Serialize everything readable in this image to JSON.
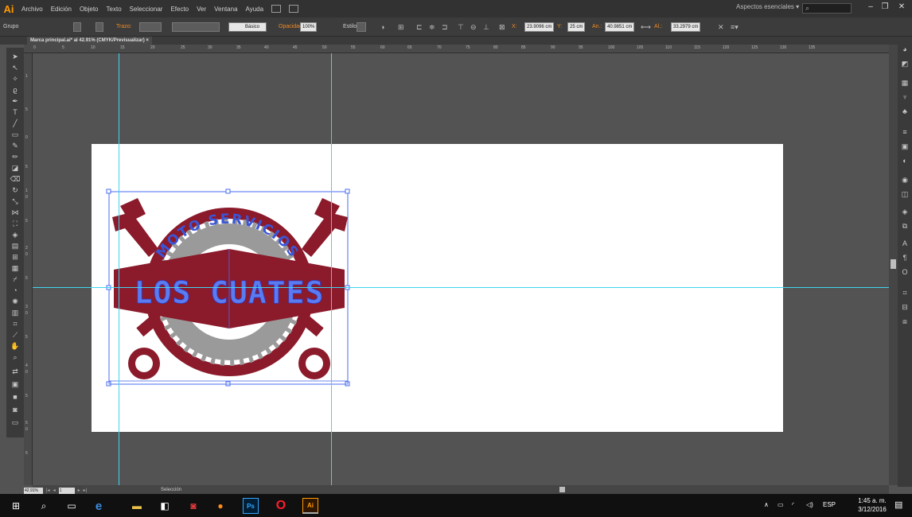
{
  "menubar": {
    "app_logo": "Ai",
    "items": [
      "Archivo",
      "Edición",
      "Objeto",
      "Texto",
      "Seleccionar",
      "Efecto",
      "Ver",
      "Ventana",
      "Ayuda"
    ],
    "workspace": "Aspectos esenciales",
    "workspace_arrow": "▾"
  },
  "controlbar": {
    "selection_type": "Grupo",
    "stroke_label": "Trazo:",
    "stroke_profile": "Básico",
    "opacity_label": "Opacidad:",
    "opacity_value": "100%",
    "style_label": "Estilo:",
    "x_label": "X:",
    "x_value": "23.9096 cm",
    "y_label": "Y:",
    "y_value": "25 cm",
    "w_label": "An.:",
    "w_value": "40.9851 cm",
    "h_label": "Al.:",
    "h_value": "33.2979 cm"
  },
  "document_tab": {
    "title": "Marca principal.ai* al 42.91% (CMYK/Previsualizar)",
    "close": "×"
  },
  "ruler_top_ticks": [
    "0",
    "5",
    "10",
    "15",
    "20",
    "25",
    "30",
    "35",
    "40",
    "45",
    "50",
    "55",
    "60",
    "65",
    "70",
    "75",
    "80",
    "85",
    "90",
    "95",
    "100",
    "105",
    "110",
    "115",
    "120",
    "125",
    "130",
    "135"
  ],
  "ruler_left_ticks": [
    "1",
    "5",
    "0",
    "5",
    "1",
    "0",
    "5",
    "2",
    "0",
    "5",
    "3",
    "0",
    "5",
    "4",
    "0",
    "5",
    "5",
    "0",
    "5"
  ],
  "artwork": {
    "arc_text": "MOTO SERVICIOS",
    "main_text": "LOS  CUATES",
    "colors": {
      "maroon": "#8b1a2b",
      "gear": "#9a9a9a",
      "selection": "#4a6cf0"
    }
  },
  "statusbar": {
    "zoom": "42.91%",
    "artboard_number": "1",
    "status_text": "Selección"
  },
  "taskbar": {
    "tray_language": "ESP",
    "time": "1:45 a. m.",
    "date": "3/12/2016"
  }
}
